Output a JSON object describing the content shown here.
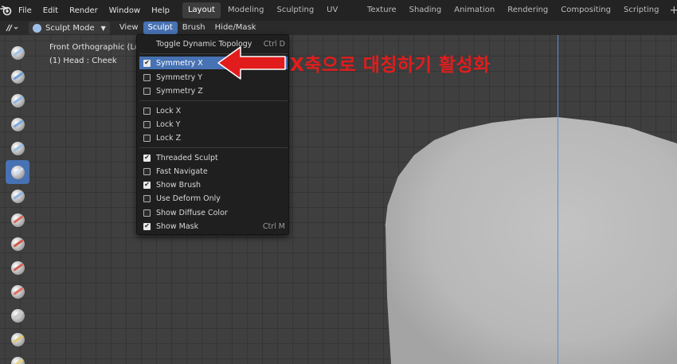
{
  "topbar": {
    "menus": [
      "File",
      "Edit",
      "Render",
      "Window",
      "Help"
    ],
    "tabs": [
      "Layout",
      "Modeling",
      "Sculpting",
      "UV Editing",
      "Texture Paint",
      "Shading",
      "Animation",
      "Rendering",
      "Compositing",
      "Scripting"
    ],
    "active_tab": "Layout",
    "add_tab": "+"
  },
  "header": {
    "mode_label": "Sculpt Mode",
    "menus": [
      "View",
      "Sculpt",
      "Brush",
      "Hide/Mask"
    ],
    "open_menu": "Sculpt"
  },
  "viewport": {
    "title": "Front Orthographic (Loca",
    "object_label": "(1) Head : Cheek",
    "mirror_axis_color": "#5c8fd6"
  },
  "dropdown": {
    "items": [
      {
        "label": "Toggle Dynamic Topology",
        "shortcut": "Ctrl D",
        "checkbox": null,
        "highlighted": false
      },
      {
        "label": "Symmetry X",
        "shortcut": "",
        "checkbox": true,
        "highlighted": true
      },
      {
        "label": "Symmetry Y",
        "shortcut": "",
        "checkbox": false,
        "highlighted": false
      },
      {
        "label": "Symmetry Z",
        "shortcut": "",
        "checkbox": false,
        "highlighted": false
      },
      {
        "label": "Lock X",
        "shortcut": "",
        "checkbox": false,
        "highlighted": false
      },
      {
        "label": "Lock Y",
        "shortcut": "",
        "checkbox": false,
        "highlighted": false
      },
      {
        "label": "Lock Z",
        "shortcut": "",
        "checkbox": false,
        "highlighted": false
      },
      {
        "label": "Threaded Sculpt",
        "shortcut": "",
        "checkbox": true,
        "highlighted": false
      },
      {
        "label": "Fast Navigate",
        "shortcut": "",
        "checkbox": false,
        "highlighted": false
      },
      {
        "label": "Show Brush",
        "shortcut": "",
        "checkbox": true,
        "highlighted": false
      },
      {
        "label": "Use Deform Only",
        "shortcut": "",
        "checkbox": false,
        "highlighted": false
      },
      {
        "label": "Show Diffuse Color",
        "shortcut": "",
        "checkbox": false,
        "highlighted": false
      },
      {
        "label": "Show Mask",
        "shortcut": "Ctrl M",
        "checkbox": true,
        "highlighted": false
      }
    ]
  },
  "annotation": {
    "text": "X축으로 대칭하기 활성화",
    "color": "#e21c1c"
  },
  "toolbar": {
    "tools": [
      "draw-brush",
      "draw-sharp-brush",
      "clay-brush",
      "clay-strips-brush",
      "clay-thumb-brush",
      "layer-brush",
      "inflate-brush",
      "blob-brush",
      "crease-brush",
      "smooth-brush",
      "flatten-brush",
      "fill-brush",
      "scrape-brush",
      "pinch-brush"
    ],
    "active_tool": "layer-brush"
  }
}
